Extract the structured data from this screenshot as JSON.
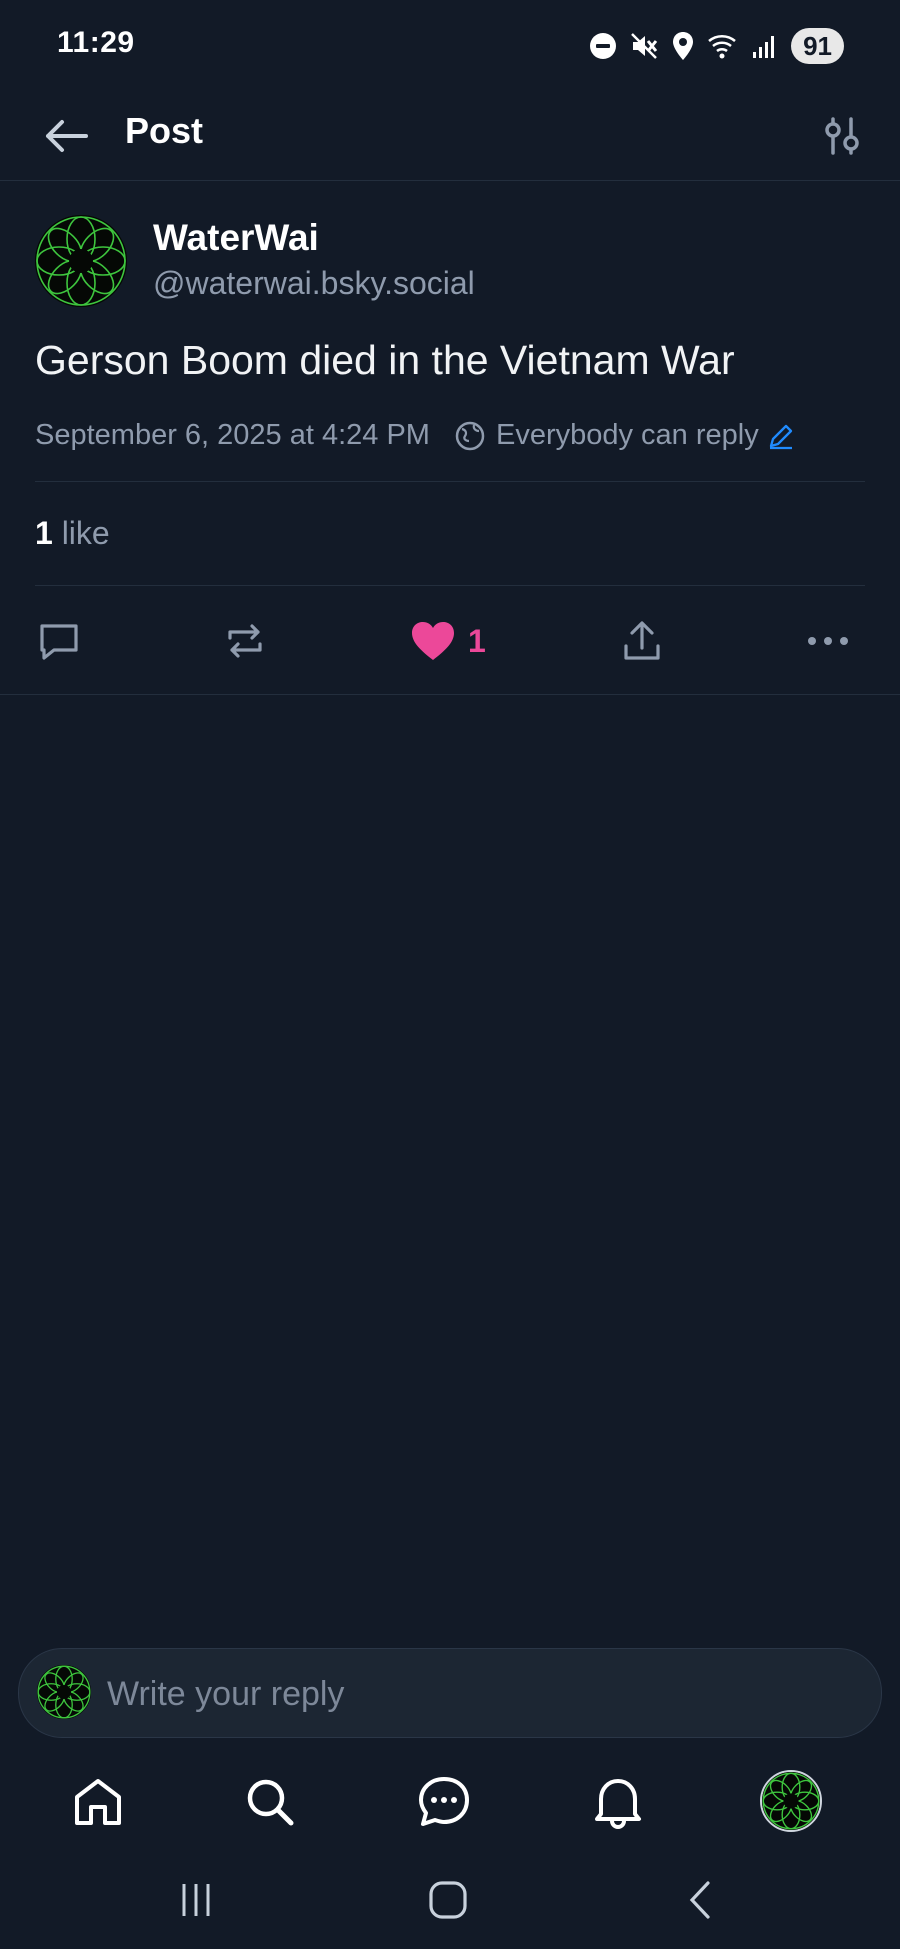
{
  "status_bar": {
    "time": "11:29",
    "battery": "91",
    "icons": [
      "do-not-disturb-icon",
      "mute-icon",
      "location-icon",
      "wifi-icon",
      "signal-icon"
    ]
  },
  "header": {
    "title": "Post",
    "back_icon": "arrow-left-icon",
    "settings_icon": "sliders-icon"
  },
  "post": {
    "author_name": "WaterWai",
    "author_handle": "@waterwai.bsky.social",
    "text": "Gerson Boom died in the Vietnam War",
    "timestamp": "September 6, 2025 at 4:24 PM",
    "reply_setting": "Everybody can reply",
    "like_count_bold": "1",
    "like_label": "like",
    "actions": {
      "like_count": "1"
    }
  },
  "reply": {
    "placeholder": "Write your reply"
  },
  "tabs": [
    "home-icon",
    "search-icon",
    "chat-icon",
    "bell-icon",
    "profile-avatar"
  ],
  "colors": {
    "background": "#121a27",
    "accent_like": "#ec4899",
    "link_blue": "#208bfe",
    "muted_text": "#8f9bad",
    "avatar_green": "#3ec53e"
  }
}
